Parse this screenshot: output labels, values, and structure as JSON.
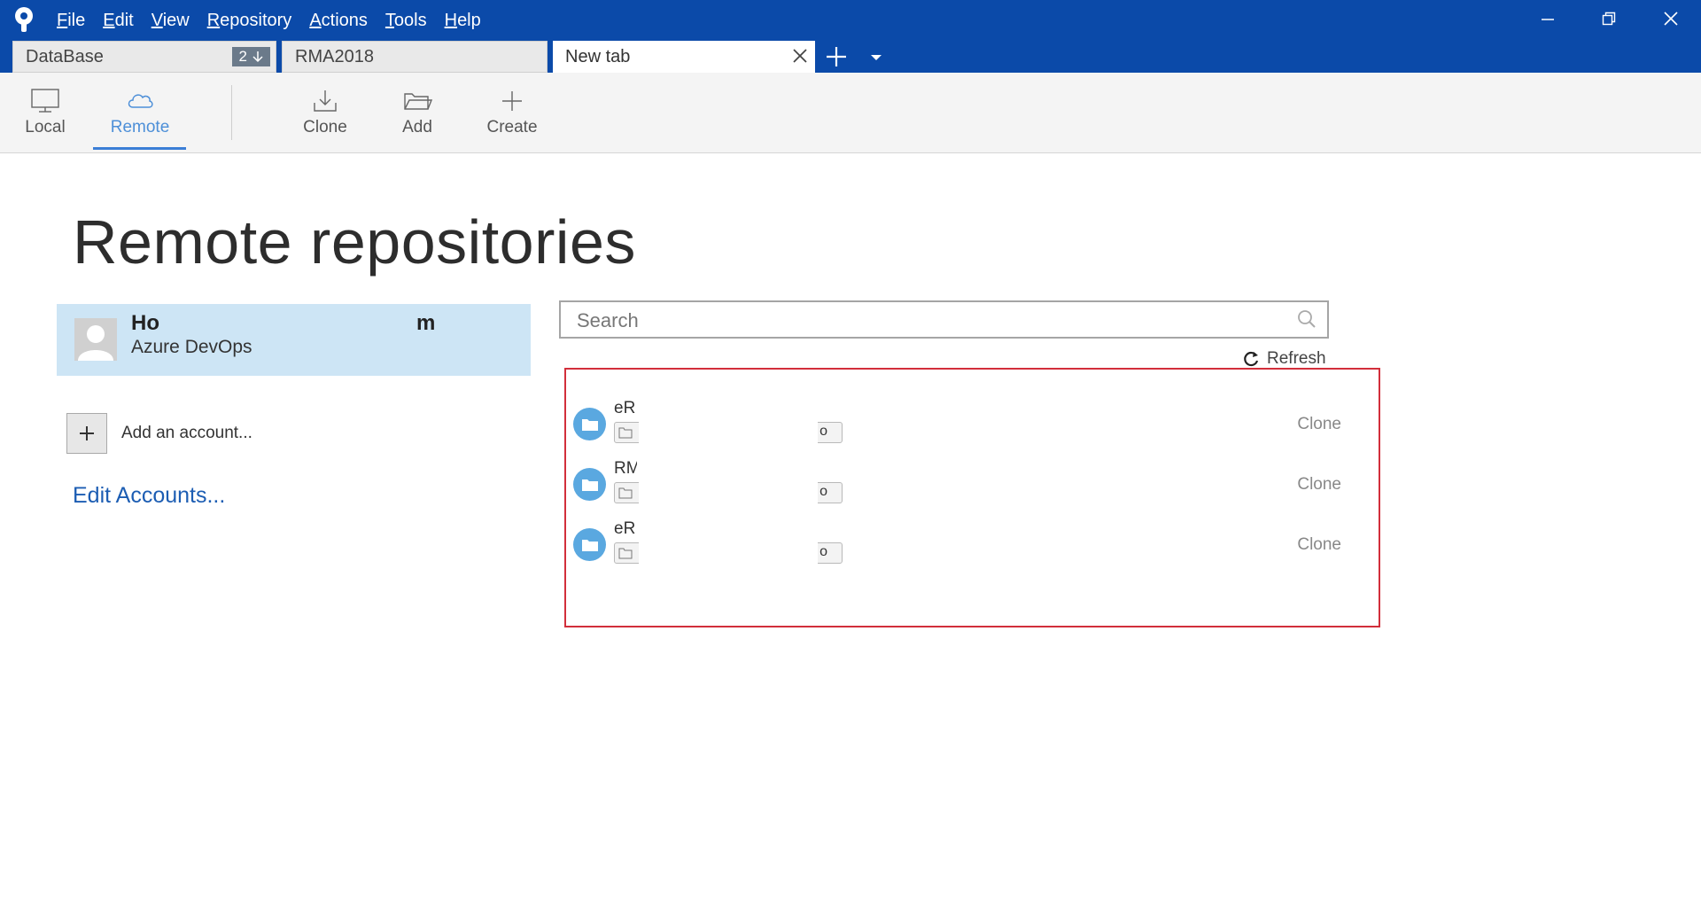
{
  "menu": {
    "items": [
      {
        "key": "F",
        "rest": "ile"
      },
      {
        "key": "E",
        "rest": "dit"
      },
      {
        "key": "V",
        "rest": "iew"
      },
      {
        "key": "R",
        "rest": "epository"
      },
      {
        "key": "A",
        "rest": "ctions"
      },
      {
        "key": "T",
        "rest": "ools"
      },
      {
        "key": "H",
        "rest": "elp"
      }
    ]
  },
  "tabs": {
    "database": {
      "label": "DataBase",
      "badge": "2"
    },
    "rma": {
      "label": "RMA2018"
    },
    "new": {
      "label": "New tab"
    }
  },
  "toolbar": {
    "local": "Local",
    "remote": "Remote",
    "clone": "Clone",
    "add": "Add",
    "create": "Create"
  },
  "main": {
    "title": "Remote repositories",
    "account": {
      "name_start": "Ho",
      "name_end": "m",
      "provider": "Azure DevOps"
    },
    "add_account": "Add an account...",
    "edit_accounts": "Edit Accounts...",
    "search_placeholder": "Search",
    "refresh": "Refresh",
    "repos": [
      {
        "name": "eRI",
        "path_tail": "o",
        "action": "Clone"
      },
      {
        "name": "RM",
        "path_tail": "o",
        "action": "Clone"
      },
      {
        "name": "eRI",
        "path_tail": "o",
        "action": "Clone"
      }
    ]
  },
  "colors": {
    "titlebar": "#0b4aa9",
    "accent": "#3b7ed6",
    "selection": "#cde5f5",
    "highlight_border": "#d22f3b",
    "repo_icon": "#5aa8e0"
  }
}
